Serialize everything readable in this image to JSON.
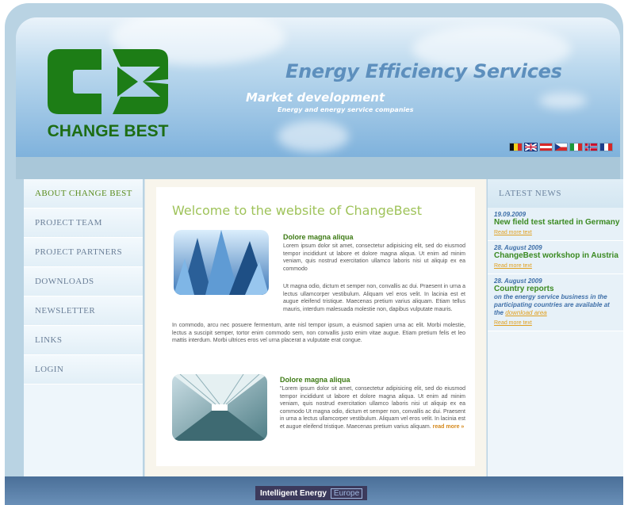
{
  "header": {
    "logo_text": "CHANGE BEST",
    "title": "Energy Efficiency Services",
    "subtitle": "Market development",
    "tagline": "Energy and energy service companies"
  },
  "nav": {
    "items": [
      {
        "label": "ABOUT CHANGE BEST"
      },
      {
        "label": "PROJECT TEAM"
      },
      {
        "label": "PROJECT PARTNERS"
      },
      {
        "label": "DOWNLOADS"
      },
      {
        "label": "NEWSLETTER"
      },
      {
        "label": "LINKS"
      },
      {
        "label": "LOGIN"
      }
    ]
  },
  "main": {
    "welcome": "Welcome to the website of ChangeBest",
    "article1": {
      "title": "Dolore magna aliqua",
      "para1": "Lorem ipsum dolor sit amet, consectetur adipisicing elit, sed do eiusmod tempor incididunt ut labore et dolore magna aliqua. Ut enim ad minim veniam, quis nostrud exercitation ullamco laboris nisi ut aliquip ex ea commodo",
      "para2": "Ut magna odio, dictum et semper non, convallis ac dui. Praesent in urna a lectus ullamcorper vestibulum. Aliquam vel eros velit. In lacinia est et augue eleifend tristique. Maecenas pretium varius aliquam. Etiam tellus mauris, interdum malesuada molestie non, dapibus vulputate mauris.",
      "para3": "In commodo, arcu nec posuere fermentum, ante nisl tempor ipsum, a euismod sapien urna ac elit. Morbi molestie, lectus a suscipit semper, tortor enim commodo sem, non convallis justo enim vitae augue. Etiam pretium felis et leo mattis interdum. Morbi ultrices eros vel urna placerat a vulputate erat congue."
    },
    "article2": {
      "title": "Dolore magna aliqua",
      "text": "\"Lorem ipsum dolor sit amet, consectetur adipisicing elit, sed do eiusmod tempor incididunt ut labore et dolore magna aliqua. Ut enim ad minim veniam, quis nostrud exercitation ullamco laboris nisi ut aliquip ex ea commodo Ut magna odio, dictum et semper non, convallis ac dui. Praesent in urna a lectus ullamcorper vestibulum. Aliquam vel eros velit. In lacinia est et augue eleifend tristique. Maecenas pretium varius aliquam.",
      "read_more": "read more »"
    }
  },
  "news": {
    "title": "LATEST NEWS",
    "items": [
      {
        "date": "19.09.2009",
        "headline": "New field test started in Germany",
        "more": "Read more text"
      },
      {
        "date": "28. August 2009",
        "headline": "ChangeBest workshop in Austria",
        "more": "Read more text"
      },
      {
        "date": "28. August 2009",
        "headline": "Country reports",
        "desc": "on the energy service business in the participating countries are available at the",
        "link": "download area",
        "more": "Read more text"
      }
    ]
  },
  "footer": {
    "badge_main": "Intelligent Energy",
    "badge_region": "Europe"
  },
  "colors": {
    "brand_green": "#1d6d14",
    "accent_orange": "#d4881b",
    "link_blue": "#3e6fa8"
  }
}
